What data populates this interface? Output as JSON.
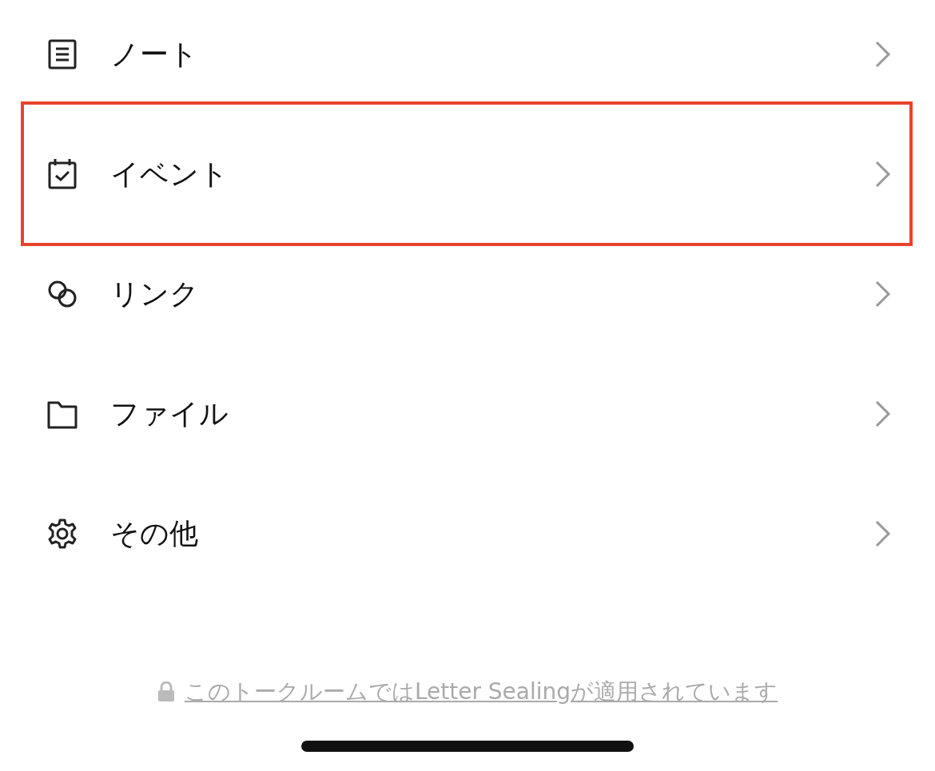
{
  "menu_items": [
    {
      "label": "ノート",
      "highlighted": false
    },
    {
      "label": "イベント",
      "highlighted": true
    },
    {
      "label": "リンク",
      "highlighted": false
    },
    {
      "label": "ファイル",
      "highlighted": false
    },
    {
      "label": "その他",
      "highlighted": false
    }
  ],
  "footer": {
    "text": "このトークルームではLetter Sealingが適用されています"
  }
}
